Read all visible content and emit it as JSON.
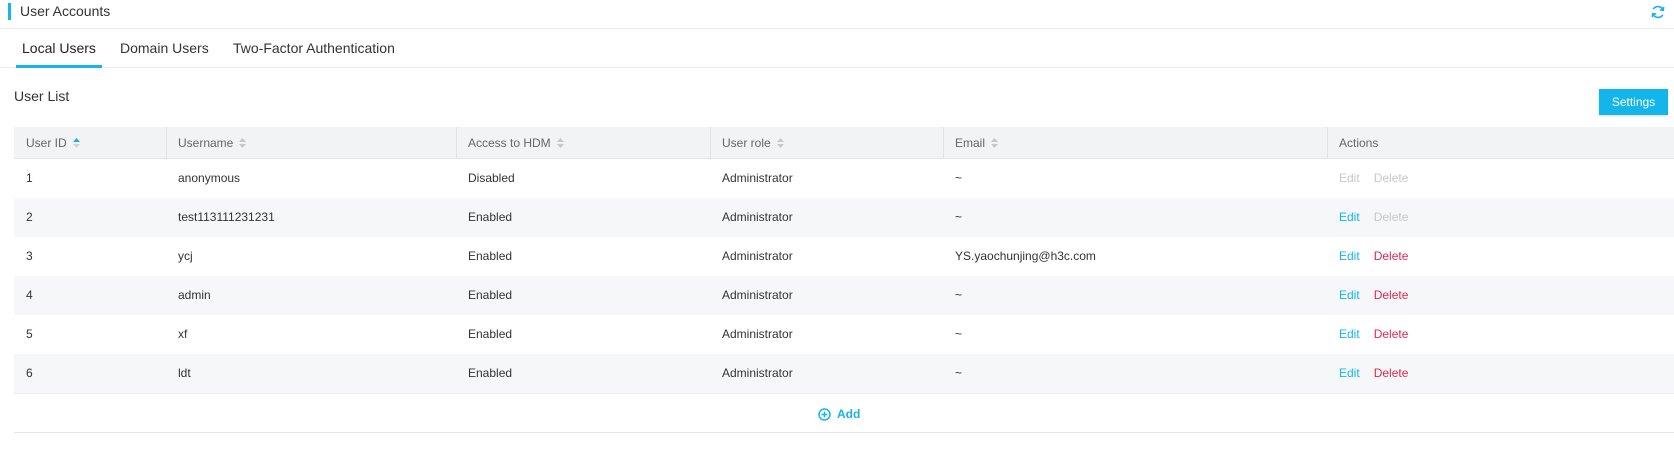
{
  "header": {
    "title": "User Accounts",
    "refresh_icon": "refresh-icon"
  },
  "tabs": [
    {
      "label": "Local Users",
      "active": true
    },
    {
      "label": "Domain Users",
      "active": false
    },
    {
      "label": "Two-Factor Authentication",
      "active": false
    }
  ],
  "section": {
    "title": "User List",
    "settings_label": "Settings"
  },
  "table": {
    "columns": [
      {
        "label": "User ID",
        "sort": "asc"
      },
      {
        "label": "Username",
        "sort": "none"
      },
      {
        "label": "Access to HDM",
        "sort": "none"
      },
      {
        "label": "User role",
        "sort": "none"
      },
      {
        "label": "Email",
        "sort": "none"
      },
      {
        "label": "Actions"
      }
    ],
    "rows": [
      {
        "id": "1",
        "username": "anonymous",
        "access": "Disabled",
        "role": "Administrator",
        "email": "~",
        "edit": "Edit",
        "delete": "Delete",
        "edit_enabled": false,
        "delete_enabled": false
      },
      {
        "id": "2",
        "username": "test113111231231",
        "access": "Enabled",
        "role": "Administrator",
        "email": "~",
        "edit": "Edit",
        "delete": "Delete",
        "edit_enabled": true,
        "delete_enabled": false
      },
      {
        "id": "3",
        "username": "ycj",
        "access": "Enabled",
        "role": "Administrator",
        "email": "YS.yaochunjing@h3c.com",
        "edit": "Edit",
        "delete": "Delete",
        "edit_enabled": true,
        "delete_enabled": true
      },
      {
        "id": "4",
        "username": "admin",
        "access": "Enabled",
        "role": "Administrator",
        "email": "~",
        "edit": "Edit",
        "delete": "Delete",
        "edit_enabled": true,
        "delete_enabled": true
      },
      {
        "id": "5",
        "username": "xf",
        "access": "Enabled",
        "role": "Administrator",
        "email": "~",
        "edit": "Edit",
        "delete": "Delete",
        "edit_enabled": true,
        "delete_enabled": true
      },
      {
        "id": "6",
        "username": "ldt",
        "access": "Enabled",
        "role": "Administrator",
        "email": "~",
        "edit": "Edit",
        "delete": "Delete",
        "edit_enabled": true,
        "delete_enabled": true
      }
    ],
    "add_label": "Add"
  },
  "colors": {
    "accent": "#13b5ea",
    "danger": "#e4264f",
    "disabled": "#c8c8c8"
  }
}
